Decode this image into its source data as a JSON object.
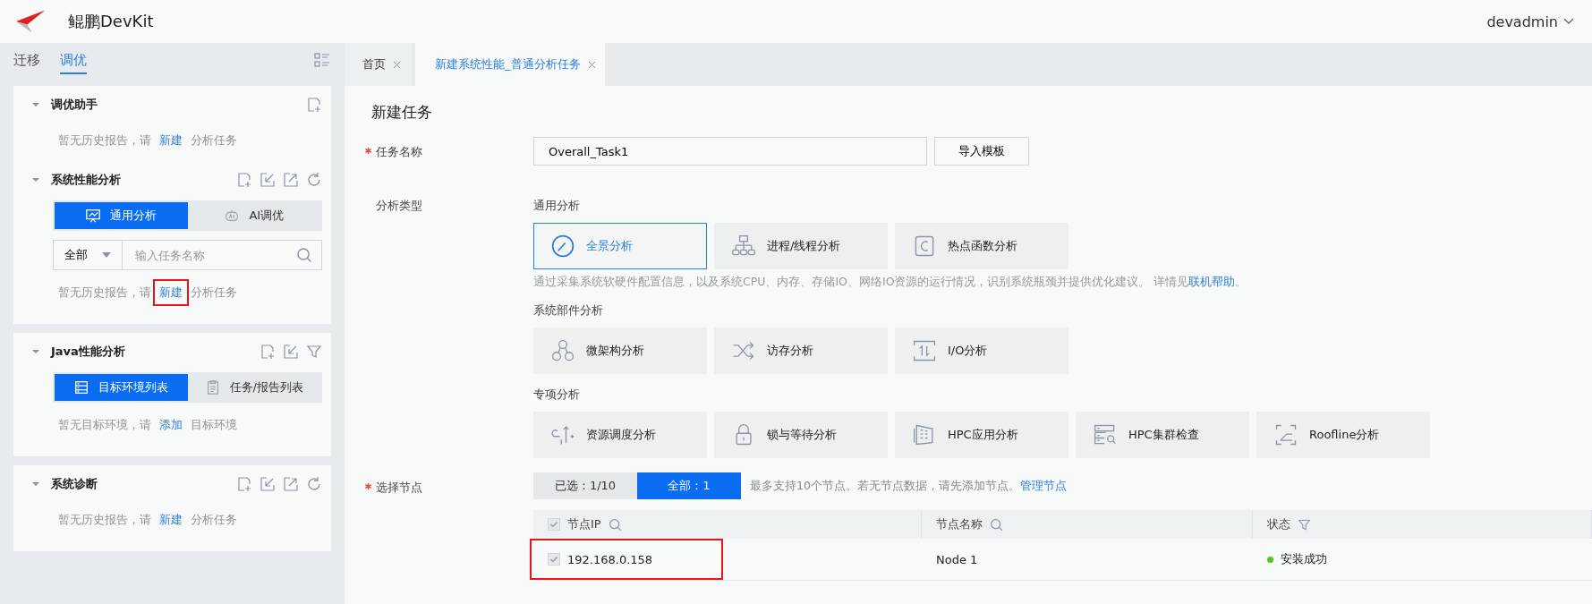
{
  "app": {
    "title": "鲲鹏DevKit",
    "user": "devadmin"
  },
  "sidebar": {
    "tabs": [
      {
        "label": "迁移",
        "selected": false
      },
      {
        "label": "调优",
        "selected": true
      }
    ],
    "cards": [
      {
        "sections": [
          {
            "title": "调优助手",
            "expanded": true,
            "kind": "assistant",
            "empty": {
              "before": "暂无历史报告，请",
              "link": "新建",
              "after": "分析任务",
              "highlighted": false
            }
          },
          {
            "title": "系统性能分析",
            "expanded": true,
            "kind": "system",
            "segments": [
              {
                "label": "通用分析",
                "selected": true
              },
              {
                "label": "AI调优",
                "selected": false
              }
            ],
            "filter": {
              "value": "全部"
            },
            "search": {
              "placeholder": "输入任务名称"
            },
            "empty": {
              "before": "暂无历史报告，请",
              "link": "新建",
              "after": "分析任务",
              "highlighted": true
            }
          }
        ]
      },
      {
        "sections": [
          {
            "title": "Java性能分析",
            "expanded": true,
            "kind": "java",
            "segments": [
              {
                "label": "目标环境列表",
                "selected": true
              },
              {
                "label": "任务/报告列表",
                "selected": false
              }
            ],
            "empty": {
              "before": "暂无目标环境，请",
              "link": "添加",
              "after": "目标环境",
              "highlighted": false
            }
          }
        ]
      },
      {
        "sections": [
          {
            "title": "系统诊断",
            "expanded": true,
            "kind": "diagnosis",
            "empty": {
              "before": "暂无历史报告，请",
              "link": "新建",
              "after": "分析任务",
              "highlighted": false
            }
          }
        ]
      }
    ]
  },
  "tabs": [
    {
      "label": "首页",
      "selected": false
    },
    {
      "label": "新建系统性能_普通分析任务",
      "selected": true
    }
  ],
  "form": {
    "heading": "新建任务",
    "task_name": {
      "label": "任务名称",
      "required": true,
      "value": "Overall_Task1",
      "button": "导入模板"
    },
    "analysis_type": {
      "label": "分析类型",
      "required": false,
      "groups": [
        {
          "title": "通用分析",
          "options": [
            {
              "label": "全景分析",
              "selected": true
            },
            {
              "label": "进程/线程分析",
              "selected": false
            },
            {
              "label": "热点函数分析",
              "selected": false
            }
          ],
          "description": {
            "text": "通过采集系统软硬件配置信息，以及系统CPU、内存、存储IO、网络IO资源的运行情况，识别系统瓶颈并提供优化建议。 详情见",
            "link": "联机帮助",
            "after": "。"
          }
        },
        {
          "title": "系统部件分析",
          "options": [
            {
              "label": "微架构分析",
              "selected": false
            },
            {
              "label": "访存分析",
              "selected": false
            },
            {
              "label": "I/O分析",
              "selected": false
            }
          ]
        },
        {
          "title": "专项分析",
          "options": [
            {
              "label": "资源调度分析",
              "selected": false
            },
            {
              "label": "锁与等待分析",
              "selected": false
            },
            {
              "label": "HPC应用分析",
              "selected": false
            },
            {
              "label": "HPC集群检查",
              "selected": false
            },
            {
              "label": "Roofline分析",
              "selected": false
            }
          ]
        }
      ]
    },
    "nodes": {
      "label": "选择节点",
      "required": true,
      "toggle": [
        {
          "label": "已选：1/10",
          "selected": false
        },
        {
          "label": "全部：1",
          "selected": true
        }
      ],
      "hint": "最多支持10个节点。若无节点数据，请先添加节点。",
      "link": "管理节点",
      "table": {
        "select_all": {
          "checked": true,
          "disabled": true
        },
        "columns": [
          {
            "label": "节点IP",
            "kind": "search"
          },
          {
            "label": "节点名称",
            "kind": "search"
          },
          {
            "label": "状态",
            "kind": "filter"
          }
        ],
        "rows": [
          {
            "checked": true,
            "disabled": true,
            "ip": "192.168.0.158",
            "name": "Node 1",
            "status": "安装成功",
            "color": "#52c41a",
            "highlighted": true
          }
        ]
      }
    }
  }
}
